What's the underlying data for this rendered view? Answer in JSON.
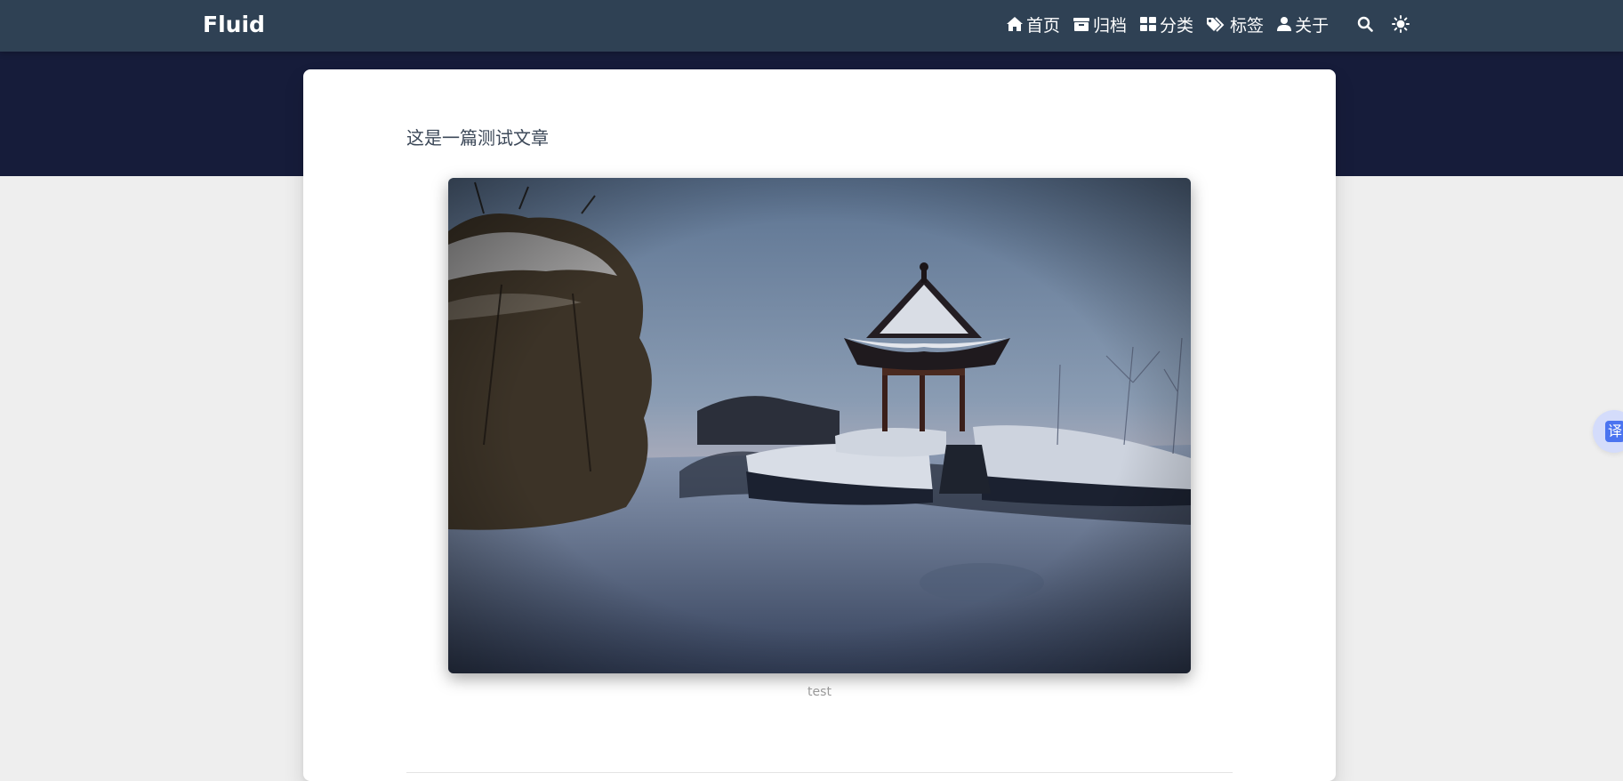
{
  "navbar": {
    "brand": "Fluid",
    "items": [
      {
        "label": "首页",
        "icon": "home-icon"
      },
      {
        "label": "归档",
        "icon": "archive-icon"
      },
      {
        "label": "分类",
        "icon": "th-large-icon"
      },
      {
        "label": "标签",
        "icon": "tags-icon"
      },
      {
        "label": "关于",
        "icon": "user-icon"
      }
    ],
    "search_icon": "search-icon",
    "theme_icon": "sun-icon"
  },
  "article": {
    "text": "这是一篇测试文章",
    "figure_caption": "test",
    "figure_subject": "snow-covered park with pagoda at dusk"
  },
  "translate_widget": {
    "glyph": "译"
  },
  "colors": {
    "navbar": "#2f4154",
    "banner": "#161c3a",
    "page_background": "#eeeeee",
    "card": "#ffffff",
    "text": "#3c4858",
    "caption": "#999999",
    "translate_accent": "#4b74f0"
  }
}
